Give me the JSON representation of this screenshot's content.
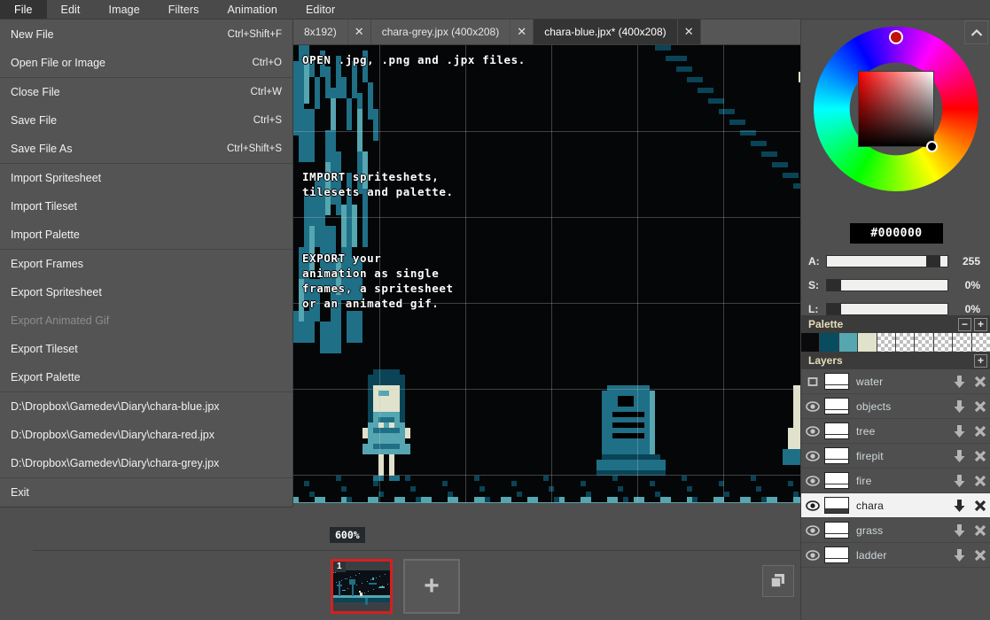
{
  "menubar": {
    "items": [
      {
        "label": "File",
        "active": true
      },
      {
        "label": "Edit",
        "active": false
      },
      {
        "label": "Image",
        "active": false
      },
      {
        "label": "Filters",
        "active": false
      },
      {
        "label": "Animation",
        "active": false
      },
      {
        "label": "Editor",
        "active": false
      }
    ]
  },
  "file_menu": {
    "groups": [
      [
        {
          "label": "New File",
          "shortcut": "Ctrl+Shift+F",
          "disabled": false
        },
        {
          "label": "Open File or Image",
          "shortcut": "Ctrl+O",
          "disabled": false
        }
      ],
      [
        {
          "label": "Close File",
          "shortcut": "Ctrl+W",
          "disabled": false
        },
        {
          "label": "Save File",
          "shortcut": "Ctrl+S",
          "disabled": false
        },
        {
          "label": "Save File As",
          "shortcut": "Ctrl+Shift+S",
          "disabled": false
        }
      ],
      [
        {
          "label": "Import Spritesheet",
          "shortcut": "",
          "disabled": false
        },
        {
          "label": "Import Tileset",
          "shortcut": "",
          "disabled": false
        },
        {
          "label": "Import Palette",
          "shortcut": "",
          "disabled": false
        }
      ],
      [
        {
          "label": "Export Frames",
          "shortcut": "",
          "disabled": false
        },
        {
          "label": "Export Spritesheet",
          "shortcut": "",
          "disabled": false
        },
        {
          "label": "Export Animated Gif",
          "shortcut": "",
          "disabled": true
        },
        {
          "label": "Export Tileset",
          "shortcut": "",
          "disabled": false
        },
        {
          "label": "Export Palette",
          "shortcut": "",
          "disabled": false
        }
      ],
      [
        {
          "label": "D:\\Dropbox\\Gamedev\\Diary\\chara-blue.jpx",
          "shortcut": "",
          "disabled": false
        },
        {
          "label": "D:\\Dropbox\\Gamedev\\Diary\\chara-red.jpx",
          "shortcut": "",
          "disabled": false
        },
        {
          "label": "D:\\Dropbox\\Gamedev\\Diary\\chara-grey.jpx",
          "shortcut": "",
          "disabled": false
        }
      ],
      [
        {
          "label": "Exit",
          "shortcut": "",
          "disabled": false
        }
      ]
    ]
  },
  "tabs": [
    {
      "label": "8x192)",
      "close": "✕",
      "active": false
    },
    {
      "label": "chara-grey.jpx (400x208)",
      "close": "✕",
      "active": false
    },
    {
      "label": "chara-blue.jpx* (400x208)",
      "close": "✕",
      "active": true
    }
  ],
  "canvas": {
    "zoom": "600%",
    "texts": [
      {
        "id": "open",
        "text": "OPEN .jpg, .png and .jpx files."
      },
      {
        "id": "import",
        "text": "IMPORT spriteshets,\ntilesets and palette."
      },
      {
        "id": "export",
        "text": "EXPORT your\nanimation as single\nframes, a spritesheet\nor an animated gif."
      }
    ]
  },
  "frames": {
    "items": [
      {
        "number": "1",
        "selected": true
      }
    ],
    "add_label": "+",
    "duplicate_icon": "duplicate-frame-icon"
  },
  "color_picker": {
    "hex": "#000000",
    "wheel_icon": "color-wheel",
    "collapse_icon": "chevron-up-icon",
    "sliders": [
      {
        "label": "A:",
        "value": "255",
        "fill": 92
      },
      {
        "label": "S:",
        "value": "0%",
        "fill": 0
      },
      {
        "label": "L:",
        "value": "0%",
        "fill": 0
      }
    ]
  },
  "palette": {
    "title": "Palette",
    "remove_label": "−",
    "add_label": "+",
    "colors": [
      "#0a0a0c",
      "#094c5f",
      "#55a6b0",
      "#e0e2cc"
    ],
    "empty_slots": 6
  },
  "layers": {
    "title": "Layers",
    "add_label": "+",
    "move_icon": "move-down-icon",
    "delete_icon": "delete-layer-icon",
    "items": [
      {
        "name": "water",
        "visible": false,
        "selected": false,
        "dark_thumb": false
      },
      {
        "name": "objects",
        "visible": true,
        "selected": false,
        "dark_thumb": false
      },
      {
        "name": "tree",
        "visible": true,
        "selected": false,
        "dark_thumb": false
      },
      {
        "name": "firepit",
        "visible": true,
        "selected": false,
        "dark_thumb": false
      },
      {
        "name": "fire",
        "visible": true,
        "selected": false,
        "dark_thumb": false
      },
      {
        "name": "chara",
        "visible": true,
        "selected": true,
        "dark_thumb": true
      },
      {
        "name": "grass",
        "visible": true,
        "selected": false,
        "dark_thumb": false
      },
      {
        "name": "ladder",
        "visible": true,
        "selected": false,
        "dark_thumb": false
      }
    ]
  },
  "theme": {
    "accent_red": "#d61f1f",
    "panel_bg": "#4f4f4f",
    "header_bg": "#3b3b3b",
    "section_title_color": "#e6ddb8",
    "layer_text_color": "#cfd8dc"
  }
}
